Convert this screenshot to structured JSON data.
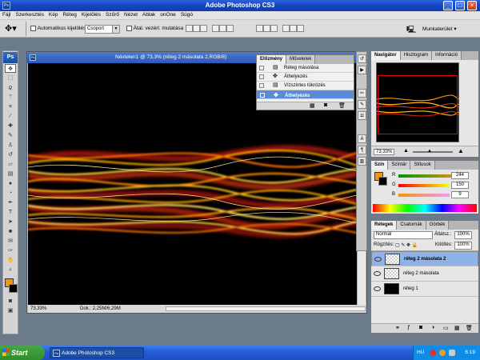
{
  "window": {
    "title": "Adobe Photoshop CS3"
  },
  "menu": [
    "Fájl",
    "Szerkesztés",
    "Kép",
    "Réteg",
    "Kijelölés",
    "Szűrő",
    "Nézet",
    "Ablak",
    "onOne",
    "Súgó"
  ],
  "options": {
    "auto_select_label": "Automatikus kijelölés",
    "auto_select_value": "Csoport",
    "transform_label": "Átal. vezérl. mutatása",
    "workspace_label": "Munkaterület"
  },
  "document": {
    "title": "Névtelen1 @ 73,3% (réteg 2 másolata 2,RGB/8)",
    "zoom": "73,33%",
    "status": "Dok.: 2,25M/6,29M"
  },
  "history": {
    "tabs": [
      "Előzmény",
      "Műveletek"
    ],
    "rows": [
      "Réteg másolása",
      "Áthelyezés",
      "Vízszintes tükrözés",
      "Áthelyezés"
    ],
    "selected_index": 3
  },
  "navigator": {
    "tabs": [
      "Navigátor",
      "Hisztogram",
      "Információ"
    ],
    "zoom": "73,33%"
  },
  "color": {
    "tabs": [
      "Szín",
      "Színtár",
      "Stílusok"
    ],
    "r": "244",
    "g": "150",
    "b": "9",
    "r_label": "R",
    "g_label": "G",
    "b_label": "B",
    "foreground": "#f49609"
  },
  "layers": {
    "tabs": [
      "Rétegek",
      "Csatornák",
      "Görbék"
    ],
    "blend_mode": "Normál",
    "opacity_label": "Átlátsz.:",
    "opacity": "100%",
    "lock_label": "Rögzítés:",
    "fill_label": "Kitöltés:",
    "fill": "100%",
    "items": [
      {
        "name": "réteg 2 másolata 2",
        "selected": true
      },
      {
        "name": "réteg 2 másolata",
        "selected": false
      },
      {
        "name": "réteg 1",
        "selected": false
      }
    ]
  },
  "taskbar": {
    "start": "Start",
    "item": "Adobe Photoshop CS3",
    "time": "6:19",
    "lang": "HU"
  }
}
